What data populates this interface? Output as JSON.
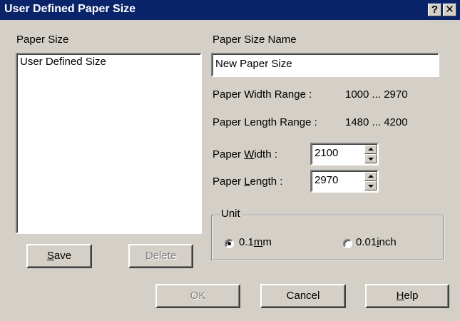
{
  "window": {
    "title": "User Defined Paper Size",
    "help_glyph": "?",
    "close_glyph": "✕"
  },
  "paper_size_list": {
    "label": "Paper Size",
    "items": [
      "User Defined Size"
    ]
  },
  "name_field": {
    "label": "Paper Size Name",
    "value": "New Paper Size"
  },
  "ranges": {
    "width_label": "Paper Width Range  :",
    "width_value": "1000 ... 2970",
    "length_label": "Paper Length Range  :",
    "length_value": "1480 ... 4200"
  },
  "width": {
    "label_pre": "Paper ",
    "label_mnemonic": "W",
    "label_post": "idth  :",
    "value": "2100"
  },
  "length": {
    "label_pre": "Paper ",
    "label_mnemonic": "L",
    "label_post": "ength  :",
    "value": "2970"
  },
  "unit": {
    "label": "Unit",
    "option1_pre": "0.1",
    "option1_mnemonic": "m",
    "option1_post": "m",
    "option1_selected": true,
    "option2_pre": "0.01",
    "option2_mnemonic": "i",
    "option2_post": "nch",
    "option2_selected": false
  },
  "buttons": {
    "save_mnemonic": "S",
    "save_rest": "ave",
    "delete_mnemonic": "D",
    "delete_rest": "elete",
    "ok": "OK",
    "cancel": "Cancel",
    "help_mnemonic": "H",
    "help_rest": "elp"
  },
  "colors": {
    "titlebar": "#0a246a",
    "face": "#d4d0c8"
  }
}
